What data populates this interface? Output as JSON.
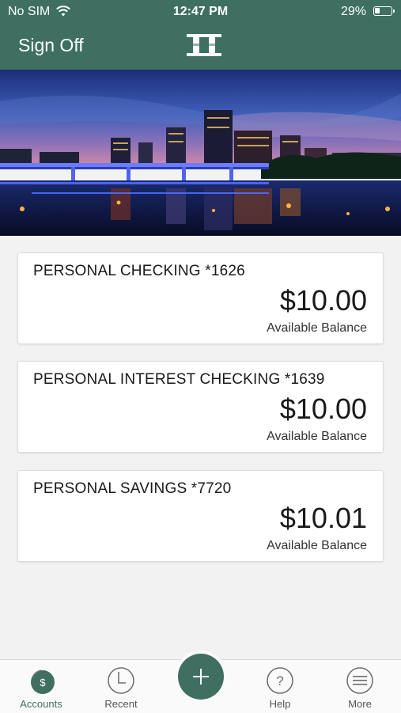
{
  "status_bar": {
    "carrier": "No SIM",
    "time": "12:47 PM",
    "battery_percent": "29%",
    "battery_level": 0.29
  },
  "header": {
    "sign_off_label": "Sign Off",
    "logo_icon": "bank-logo-icon",
    "background_color": "#3f6f60"
  },
  "hero": {
    "image": "city-skyline-night"
  },
  "accounts": [
    {
      "name": "PERSONAL CHECKING *1626",
      "balance": "$10.00",
      "caption": "Available Balance"
    },
    {
      "name": "PERSONAL INTEREST CHECKING *1639",
      "balance": "$10.00",
      "caption": "Available Balance"
    },
    {
      "name": "PERSONAL SAVINGS *7720",
      "balance": "$10.01",
      "caption": "Available Balance"
    }
  ],
  "tabbar": {
    "items": [
      {
        "label": "Accounts",
        "icon": "accounts-icon",
        "active": true
      },
      {
        "label": "Recent",
        "icon": "clock-icon",
        "active": false
      },
      {
        "label": "",
        "icon": "plus-icon",
        "active": false
      },
      {
        "label": "Help",
        "icon": "help-icon",
        "active": false
      },
      {
        "label": "More",
        "icon": "menu-icon",
        "active": false
      }
    ],
    "accent_color": "#3f6f60"
  }
}
